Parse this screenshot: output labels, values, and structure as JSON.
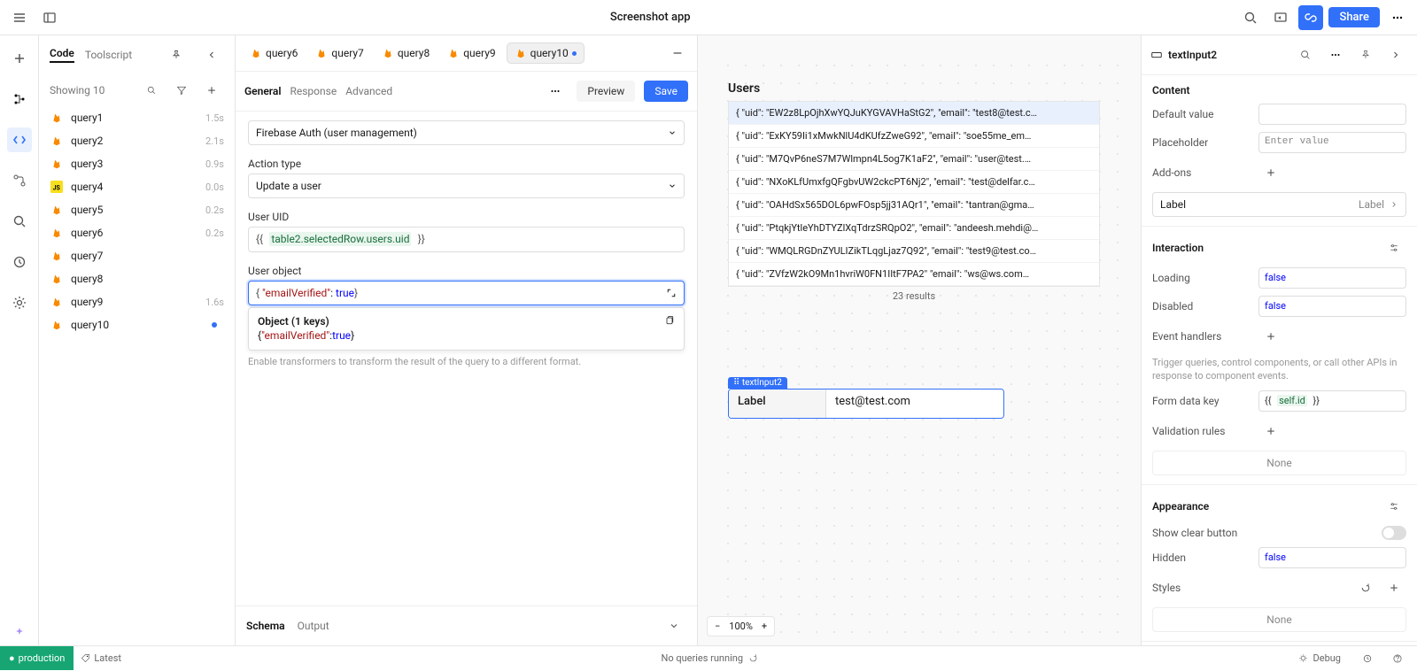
{
  "topbar": {
    "title": "Screenshot app",
    "share": "Share"
  },
  "rail_active_index": 2,
  "qlist": {
    "tabs": [
      "Code",
      "Toolscript"
    ],
    "active_tab": 0,
    "sub": "Showing 10",
    "items": [
      {
        "name": "query1",
        "time": "1.5s",
        "icon": "fire"
      },
      {
        "name": "query2",
        "time": "2.1s",
        "icon": "fire"
      },
      {
        "name": "query3",
        "time": "0.9s",
        "icon": "fire"
      },
      {
        "name": "query4",
        "time": "0.0s",
        "icon": "js"
      },
      {
        "name": "query5",
        "time": "0.2s",
        "icon": "fire"
      },
      {
        "name": "query6",
        "time": "0.2s",
        "icon": "fire"
      },
      {
        "name": "query7",
        "time": "",
        "icon": "fire"
      },
      {
        "name": "query8",
        "time": "",
        "icon": "fire"
      },
      {
        "name": "query9",
        "time": "1.6s",
        "icon": "fire"
      },
      {
        "name": "query10",
        "time": "",
        "icon": "fire",
        "unsaved": true
      }
    ]
  },
  "editor": {
    "open_tabs": [
      {
        "name": "query6"
      },
      {
        "name": "query7"
      },
      {
        "name": "query8"
      },
      {
        "name": "query9"
      },
      {
        "name": "query10",
        "active": true,
        "unsaved": true
      }
    ],
    "head_tabs": [
      "General",
      "Response",
      "Advanced"
    ],
    "head_active": 0,
    "preview": "Preview",
    "save": "Save",
    "resource": "Firebase Auth (user management)",
    "action_label": "Action type",
    "action_value": "Update a user",
    "uid_label": "User UID",
    "uid_expr_open": "{{",
    "uid_expr": "table2.selectedRow.users.uid",
    "uid_expr_close": "}}",
    "obj_label": "User object",
    "obj_text_open": "{",
    "obj_key": "\"emailVerified\"",
    "obj_sep": ": ",
    "obj_val": "true",
    "obj_text_close": "}",
    "pop_title": "Object (1 keys)",
    "pop_body_open": "{",
    "pop_body_key": "\"emailVerified\"",
    "pop_body_sep": ":",
    "pop_body_val": "true",
    "pop_body_close": "}",
    "hint": "Enable transformers to transform the result of the query to a different format.",
    "footer_tabs": [
      "Schema",
      "Output"
    ],
    "footer_active": 0
  },
  "canvas": {
    "users_title": "Users",
    "rows": [
      "{ \"uid\": \"EW2z8LpOjhXwYQJuKYGVAVHaStG2\", \"email\": \"test8@test.c…",
      "{ \"uid\": \"ExKY59Ii1xMwkNlU4dKUfzZweG92\", \"email\": \"soe55me_em…",
      "{ \"uid\": \"M7QvP6neS7M7Wlmpn4L5og7K1aF2\", \"email\": \"user@test.…",
      "{ \"uid\": \"NXoKLfUmxfgQFgbvUW2ckcPT6Nj2\", \"email\": \"test@delfar.c…",
      "{ \"uid\": \"OAHdSx565DOL6pwFOsp5jj31AQr1\", \"email\": \"tantran@gma…",
      "{ \"uid\": \"PtqkjYtleYhDTYZlXqTdrzSRQpO2\", \"email\": \"andeesh.mehdi@…",
      "{ \"uid\": \"WMQLRGDnZYULIZikTLqgLjaz7Q92\", \"email\": \"test9@test.co…",
      "{ \"uid\": \"ZVfzW2kO9Mn1hvriW0FN1IItF7PA2\" \"email\": \"ws@ws.com…"
    ],
    "selected_row_index": 0,
    "count": "23 results",
    "text_tag": "textInput2",
    "text_label": "Label",
    "text_value": "test@test.com",
    "zoom": "100%"
  },
  "inspector": {
    "component": "textInput2",
    "sections": {
      "content": "Content",
      "interaction": "Interaction",
      "appearance": "Appearance"
    },
    "default_value": "Default value",
    "default_value_val": "",
    "placeholder": "Placeholder",
    "placeholder_val": "Enter value",
    "addons": "Add-ons",
    "addons_row_label": "Label",
    "addons_row_val": "Label",
    "loading": "Loading",
    "loading_val": "false",
    "disabled": "Disabled",
    "disabled_val": "false",
    "events": "Event handlers",
    "events_note": "Trigger queries, control components, or call other APIs in response to component events.",
    "form_key": "Form data key",
    "form_key_open": "{{",
    "form_key_expr": "self.id",
    "form_key_close": "}}",
    "validation": "Validation rules",
    "none": "None",
    "show_clear": "Show clear button",
    "hidden": "Hidden",
    "hidden_val": "false",
    "styles": "Styles"
  },
  "status": {
    "env": "production",
    "latest": "Latest",
    "queries": "No queries running",
    "debug": "Debug"
  }
}
